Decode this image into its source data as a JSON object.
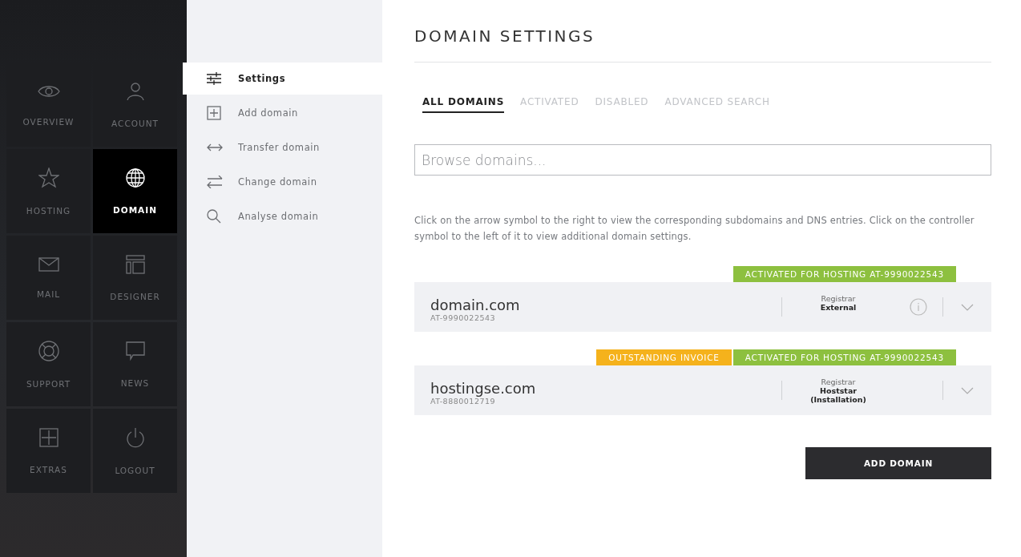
{
  "sidebar": {
    "tiles": [
      {
        "label": "OVERVIEW",
        "selected": false
      },
      {
        "label": "ACCOUNT",
        "selected": false
      },
      {
        "label": "HOSTING",
        "selected": false
      },
      {
        "label": "DOMAIN",
        "selected": true
      },
      {
        "label": "MAIL",
        "selected": false
      },
      {
        "label": "DESIGNER",
        "selected": false
      },
      {
        "label": "SUPPORT",
        "selected": false
      },
      {
        "label": "NEWS",
        "selected": false
      },
      {
        "label": "EXTRAS",
        "selected": false
      },
      {
        "label": "LOGOUT",
        "selected": false
      }
    ]
  },
  "submenu": {
    "items": [
      {
        "label": "Settings",
        "selected": true
      },
      {
        "label": "Add domain",
        "selected": false
      },
      {
        "label": "Transfer domain",
        "selected": false
      },
      {
        "label": "Change domain",
        "selected": false
      },
      {
        "label": "Analyse domain",
        "selected": false
      }
    ]
  },
  "main": {
    "title": "DOMAIN SETTINGS",
    "tabs": [
      {
        "label": "ALL DOMAINS",
        "selected": true
      },
      {
        "label": "ACTIVATED",
        "selected": false
      },
      {
        "label": "DISABLED",
        "selected": false
      },
      {
        "label": "ADVANCED SEARCH",
        "selected": false
      }
    ],
    "search": {
      "placeholder": "Browse domains..."
    },
    "hint": "Click on the arrow symbol to the right to view the corresponding subdomains and DNS entries. Click on the controller symbol to the left of it to view additional domain settings.",
    "domains": [
      {
        "name": "domain.com",
        "id": "AT-9990022543",
        "registrar_label": "Registrar",
        "registrar": "External",
        "info": true,
        "badges": [
          {
            "label": "ACTIVATED FOR HOSTING AT-9990022543",
            "color": "#8dc03f"
          }
        ]
      },
      {
        "name": "hostingse.com",
        "id": "AT-8880012719",
        "registrar_label": "Registrar",
        "registrar": "Hoststar (Installation)",
        "info": false,
        "badges": [
          {
            "label": "OUTSTANDING INVOICE",
            "color": "#f5b21c"
          },
          {
            "label": "ACTIVATED FOR HOSTING AT-9990022543",
            "color": "#8dc03f"
          }
        ]
      }
    ],
    "add_button": "ADD DOMAIN"
  }
}
